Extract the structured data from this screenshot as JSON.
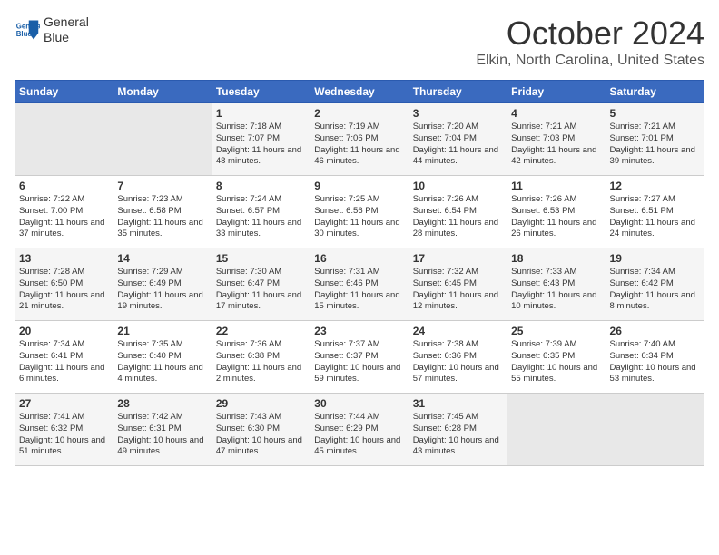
{
  "header": {
    "logo_line1": "General",
    "logo_line2": "Blue",
    "month": "October 2024",
    "location": "Elkin, North Carolina, United States"
  },
  "days_of_week": [
    "Sunday",
    "Monday",
    "Tuesday",
    "Wednesday",
    "Thursday",
    "Friday",
    "Saturday"
  ],
  "weeks": [
    [
      {
        "day": "",
        "content": ""
      },
      {
        "day": "",
        "content": ""
      },
      {
        "day": "1",
        "content": "Sunrise: 7:18 AM\nSunset: 7:07 PM\nDaylight: 11 hours and 48 minutes."
      },
      {
        "day": "2",
        "content": "Sunrise: 7:19 AM\nSunset: 7:06 PM\nDaylight: 11 hours and 46 minutes."
      },
      {
        "day": "3",
        "content": "Sunrise: 7:20 AM\nSunset: 7:04 PM\nDaylight: 11 hours and 44 minutes."
      },
      {
        "day": "4",
        "content": "Sunrise: 7:21 AM\nSunset: 7:03 PM\nDaylight: 11 hours and 42 minutes."
      },
      {
        "day": "5",
        "content": "Sunrise: 7:21 AM\nSunset: 7:01 PM\nDaylight: 11 hours and 39 minutes."
      }
    ],
    [
      {
        "day": "6",
        "content": "Sunrise: 7:22 AM\nSunset: 7:00 PM\nDaylight: 11 hours and 37 minutes."
      },
      {
        "day": "7",
        "content": "Sunrise: 7:23 AM\nSunset: 6:58 PM\nDaylight: 11 hours and 35 minutes."
      },
      {
        "day": "8",
        "content": "Sunrise: 7:24 AM\nSunset: 6:57 PM\nDaylight: 11 hours and 33 minutes."
      },
      {
        "day": "9",
        "content": "Sunrise: 7:25 AM\nSunset: 6:56 PM\nDaylight: 11 hours and 30 minutes."
      },
      {
        "day": "10",
        "content": "Sunrise: 7:26 AM\nSunset: 6:54 PM\nDaylight: 11 hours and 28 minutes."
      },
      {
        "day": "11",
        "content": "Sunrise: 7:26 AM\nSunset: 6:53 PM\nDaylight: 11 hours and 26 minutes."
      },
      {
        "day": "12",
        "content": "Sunrise: 7:27 AM\nSunset: 6:51 PM\nDaylight: 11 hours and 24 minutes."
      }
    ],
    [
      {
        "day": "13",
        "content": "Sunrise: 7:28 AM\nSunset: 6:50 PM\nDaylight: 11 hours and 21 minutes."
      },
      {
        "day": "14",
        "content": "Sunrise: 7:29 AM\nSunset: 6:49 PM\nDaylight: 11 hours and 19 minutes."
      },
      {
        "day": "15",
        "content": "Sunrise: 7:30 AM\nSunset: 6:47 PM\nDaylight: 11 hours and 17 minutes."
      },
      {
        "day": "16",
        "content": "Sunrise: 7:31 AM\nSunset: 6:46 PM\nDaylight: 11 hours and 15 minutes."
      },
      {
        "day": "17",
        "content": "Sunrise: 7:32 AM\nSunset: 6:45 PM\nDaylight: 11 hours and 12 minutes."
      },
      {
        "day": "18",
        "content": "Sunrise: 7:33 AM\nSunset: 6:43 PM\nDaylight: 11 hours and 10 minutes."
      },
      {
        "day": "19",
        "content": "Sunrise: 7:34 AM\nSunset: 6:42 PM\nDaylight: 11 hours and 8 minutes."
      }
    ],
    [
      {
        "day": "20",
        "content": "Sunrise: 7:34 AM\nSunset: 6:41 PM\nDaylight: 11 hours and 6 minutes."
      },
      {
        "day": "21",
        "content": "Sunrise: 7:35 AM\nSunset: 6:40 PM\nDaylight: 11 hours and 4 minutes."
      },
      {
        "day": "22",
        "content": "Sunrise: 7:36 AM\nSunset: 6:38 PM\nDaylight: 11 hours and 2 minutes."
      },
      {
        "day": "23",
        "content": "Sunrise: 7:37 AM\nSunset: 6:37 PM\nDaylight: 10 hours and 59 minutes."
      },
      {
        "day": "24",
        "content": "Sunrise: 7:38 AM\nSunset: 6:36 PM\nDaylight: 10 hours and 57 minutes."
      },
      {
        "day": "25",
        "content": "Sunrise: 7:39 AM\nSunset: 6:35 PM\nDaylight: 10 hours and 55 minutes."
      },
      {
        "day": "26",
        "content": "Sunrise: 7:40 AM\nSunset: 6:34 PM\nDaylight: 10 hours and 53 minutes."
      }
    ],
    [
      {
        "day": "27",
        "content": "Sunrise: 7:41 AM\nSunset: 6:32 PM\nDaylight: 10 hours and 51 minutes."
      },
      {
        "day": "28",
        "content": "Sunrise: 7:42 AM\nSunset: 6:31 PM\nDaylight: 10 hours and 49 minutes."
      },
      {
        "day": "29",
        "content": "Sunrise: 7:43 AM\nSunset: 6:30 PM\nDaylight: 10 hours and 47 minutes."
      },
      {
        "day": "30",
        "content": "Sunrise: 7:44 AM\nSunset: 6:29 PM\nDaylight: 10 hours and 45 minutes."
      },
      {
        "day": "31",
        "content": "Sunrise: 7:45 AM\nSunset: 6:28 PM\nDaylight: 10 hours and 43 minutes."
      },
      {
        "day": "",
        "content": ""
      },
      {
        "day": "",
        "content": ""
      }
    ]
  ]
}
